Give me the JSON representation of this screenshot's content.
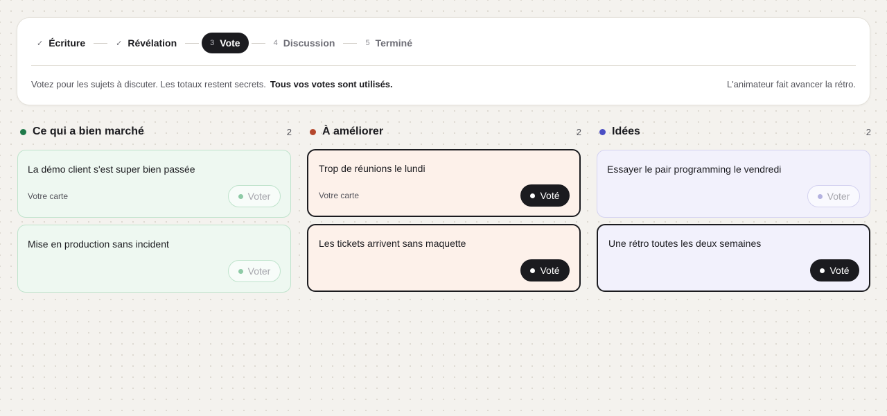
{
  "stepper": {
    "steps": [
      {
        "mark": "✓",
        "label": "Écriture",
        "state": "done"
      },
      {
        "mark": "✓",
        "label": "Révélation",
        "state": "done"
      },
      {
        "mark": "3",
        "label": "Vote",
        "state": "active"
      },
      {
        "mark": "4",
        "label": "Discussion",
        "state": "todo"
      },
      {
        "mark": "5",
        "label": "Terminé",
        "state": "todo"
      }
    ]
  },
  "info": {
    "text": "Votez pour les sujets à discuter. Les totaux restent secrets.",
    "emphasis": "Tous vos votes sont utilisés.",
    "facilitator": "L'animateur fait avancer la rétro."
  },
  "columns": [
    {
      "title": "Ce qui a bien marché",
      "count": "2",
      "color": "#1f7a4a",
      "card_bg": "#eef8f1",
      "card_border": "#bfe3cc",
      "vote_dot": "#8ecaa6",
      "cards": [
        {
          "text": "La démo client s'est super bien passée",
          "own": "Votre carte",
          "vote_label": "Voter",
          "voted": false
        },
        {
          "text": "Mise en production sans incident",
          "own": "",
          "vote_label": "Voter",
          "voted": false
        }
      ]
    },
    {
      "title": "À améliorer",
      "count": "2",
      "color": "#b5472c",
      "card_bg": "#fdf1ea",
      "card_border": "#efcdbc",
      "vote_dot": "#e3a58e",
      "cards": [
        {
          "text": "Trop de réunions le lundi",
          "own": "Votre carte",
          "vote_label": "Voté",
          "voted": true
        },
        {
          "text": "Les tickets arrivent sans maquette",
          "own": "",
          "vote_label": "Voté",
          "voted": true
        }
      ]
    },
    {
      "title": "Idées",
      "count": "2",
      "color": "#4b4fc4",
      "card_bg": "#f2f1fc",
      "card_border": "#d4d2f0",
      "vote_dot": "#b4b2e0",
      "cards": [
        {
          "text": "Essayer le pair programming le vendredi",
          "own": "",
          "vote_label": "Voter",
          "voted": false
        },
        {
          "text": "Une rétro toutes les deux semaines",
          "own": "",
          "vote_label": "Voté",
          "voted": true
        }
      ]
    }
  ]
}
